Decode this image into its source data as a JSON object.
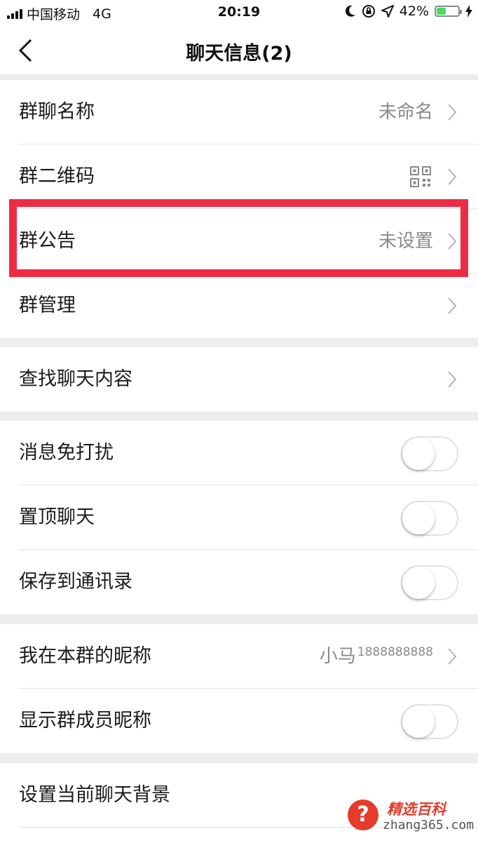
{
  "status_bar": {
    "carrier": "中国移动",
    "network": "4G",
    "time": "20:19",
    "battery_percent": "42%",
    "battery_level": 0.42,
    "icons": [
      "moon-icon",
      "rotation-lock-icon",
      "location-arrow-icon",
      "charging-bolt-icon"
    ]
  },
  "nav": {
    "back_icon": "chevron-left-icon",
    "title": "聊天信息(2)"
  },
  "group1": [
    {
      "label": "群聊名称",
      "value": "未命名"
    },
    {
      "label": "群二维码",
      "icon": "qr-code-icon"
    },
    {
      "label": "群公告",
      "value": "未设置"
    },
    {
      "label": "群管理"
    }
  ],
  "group2": [
    {
      "label": "查找聊天内容"
    }
  ],
  "group3": [
    {
      "label": "消息免打扰",
      "on": false
    },
    {
      "label": "置顶聊天",
      "on": false
    },
    {
      "label": "保存到通讯录",
      "on": false
    }
  ],
  "group4": {
    "nickname": {
      "label": "我在本群的昵称",
      "value_main": "小马",
      "value_sup": "1888888888"
    },
    "show_nicknames": {
      "label": "显示群成员昵称",
      "on": false
    }
  },
  "group5": [
    {
      "label": "设置当前聊天背景"
    }
  ],
  "watermark": {
    "badge": "?",
    "title": "精选百科",
    "url": "zhang365.com"
  },
  "colors": {
    "highlight": "#ee2b44",
    "battery": "#4cd964",
    "background": "#ededed",
    "watermark": "#e53b2c"
  }
}
